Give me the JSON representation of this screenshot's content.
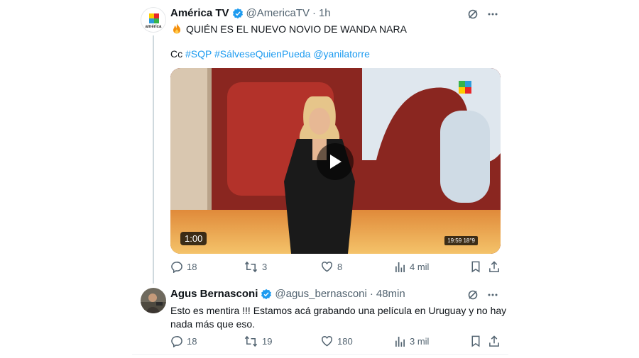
{
  "tweets": [
    {
      "name": "América TV",
      "handle": "@AmericaTV",
      "time": "1h",
      "avatar_label": "américa",
      "line1": "QUIÉN ES EL NUEVO NOVIO DE WANDA NARA",
      "line2_prefix": "Cc",
      "tags": [
        "#SQP",
        "#SálveseQuienPueda",
        "@yanilatorre"
      ],
      "video_duration": "1:00",
      "video_clock": "19:59",
      "video_temp": "18°9",
      "replies": "18",
      "retweets": "3",
      "likes": "8",
      "views": "4 mil"
    },
    {
      "name": "Agus Bernasconi",
      "handle": "@agus_bernasconi",
      "time": "48min",
      "line1": "Esto es mentira !!! Estamos acá grabando una película en Uruguay y no hay",
      "line2": "nada más que eso.",
      "replies": "18",
      "retweets": "19",
      "likes": "180",
      "views": "3 mil"
    }
  ],
  "dot": "·",
  "colors": {
    "accent": "#1d9bf0",
    "muted": "#536471",
    "verified": "#1d9bf0"
  },
  "icons": [
    "fire-icon",
    "verified-icon",
    "grok-icon",
    "more-icon",
    "reply-icon",
    "retweet-icon",
    "like-icon",
    "views-icon",
    "bookmark-icon",
    "share-icon",
    "play-icon"
  ]
}
